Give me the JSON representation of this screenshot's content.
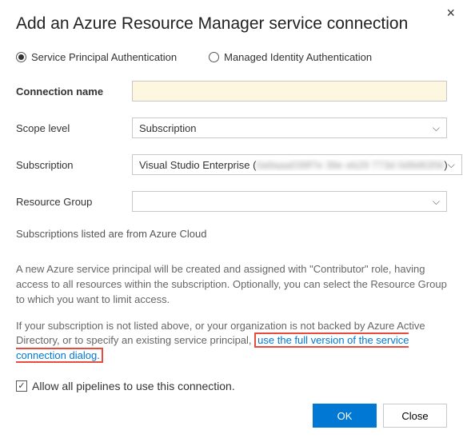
{
  "title": "Add an Azure Resource Manager service connection",
  "auth": {
    "service_principal": "Service Principal Authentication",
    "managed_identity": "Managed Identity Authentication"
  },
  "fields": {
    "connection_name": {
      "label": "Connection name",
      "value": ""
    },
    "scope_level": {
      "label": "Scope level",
      "value": "Subscription"
    },
    "subscription": {
      "label": "Subscription",
      "prefix": "Visual Studio Enterprise (",
      "redacted": "0a9aaa039f7e 39e eb29 773d 0d9d6356",
      "suffix": ")"
    },
    "resource_group": {
      "label": "Resource Group",
      "value": ""
    }
  },
  "info": {
    "cloud": "Subscriptions listed are from Azure Cloud",
    "sp_desc": "A new Azure service principal will be created and assigned with \"Contributor\" role, having access to all resources within the subscription. Optionally, you can select the Resource Group to which you want to limit access.",
    "fallback_prefix": "If your subscription is not listed above, or your organization is not backed by Azure Active Directory, or to specify an existing service principal, ",
    "fallback_link": "use the full version of the service connection dialog."
  },
  "allow_all": "Allow all pipelines to use this connection.",
  "buttons": {
    "ok": "OK",
    "close": "Close"
  }
}
